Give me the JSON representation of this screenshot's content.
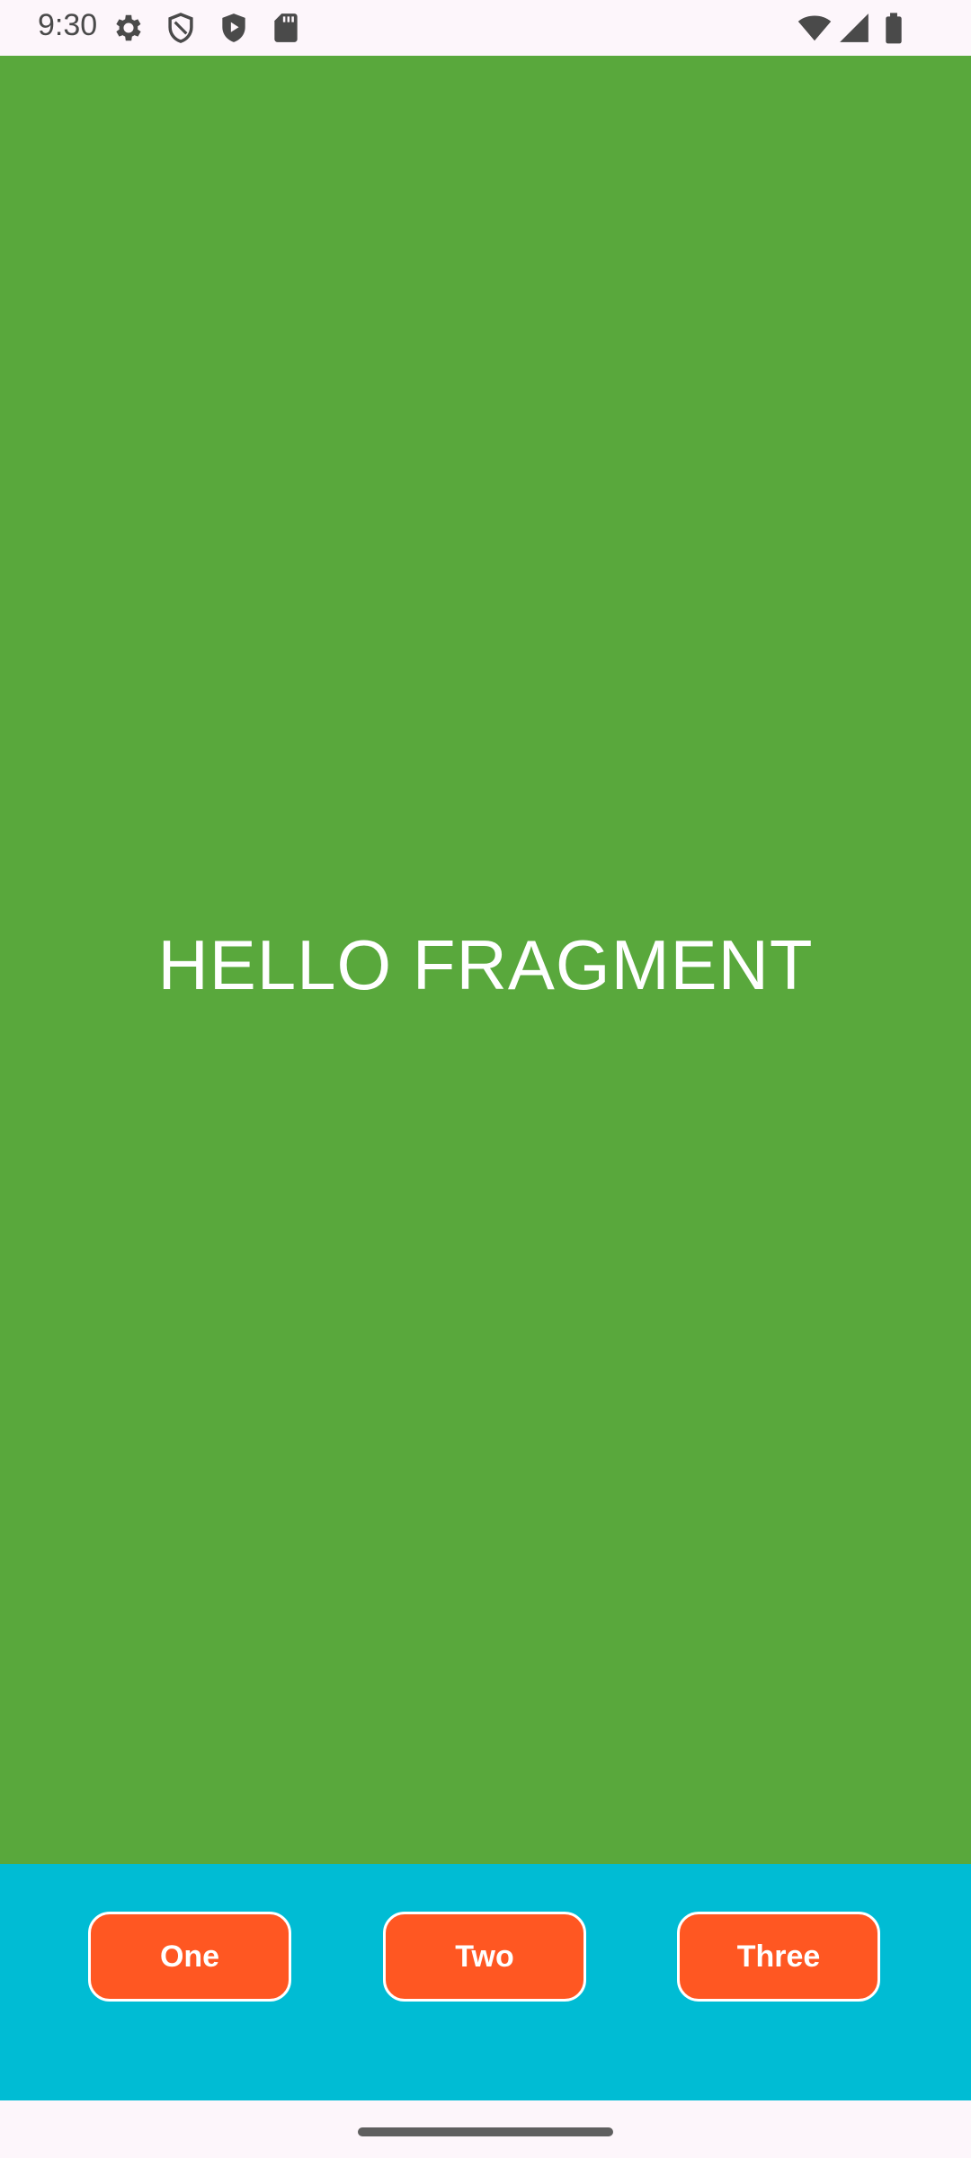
{
  "status_bar": {
    "time": "9:30",
    "left_icons": [
      "gear-icon",
      "shield-outline-icon",
      "shield-play-icon",
      "sd-card-icon"
    ],
    "right_icons": [
      "wifi-icon",
      "signal-icon",
      "battery-icon"
    ]
  },
  "fragment": {
    "text": "HELLO FRAGMENT",
    "background_color": "#59a83c"
  },
  "button_bar": {
    "background_color": "#00bcd4",
    "button_color": "#ff5722",
    "buttons": [
      {
        "label": "One"
      },
      {
        "label": "Two"
      },
      {
        "label": "Three"
      }
    ]
  }
}
